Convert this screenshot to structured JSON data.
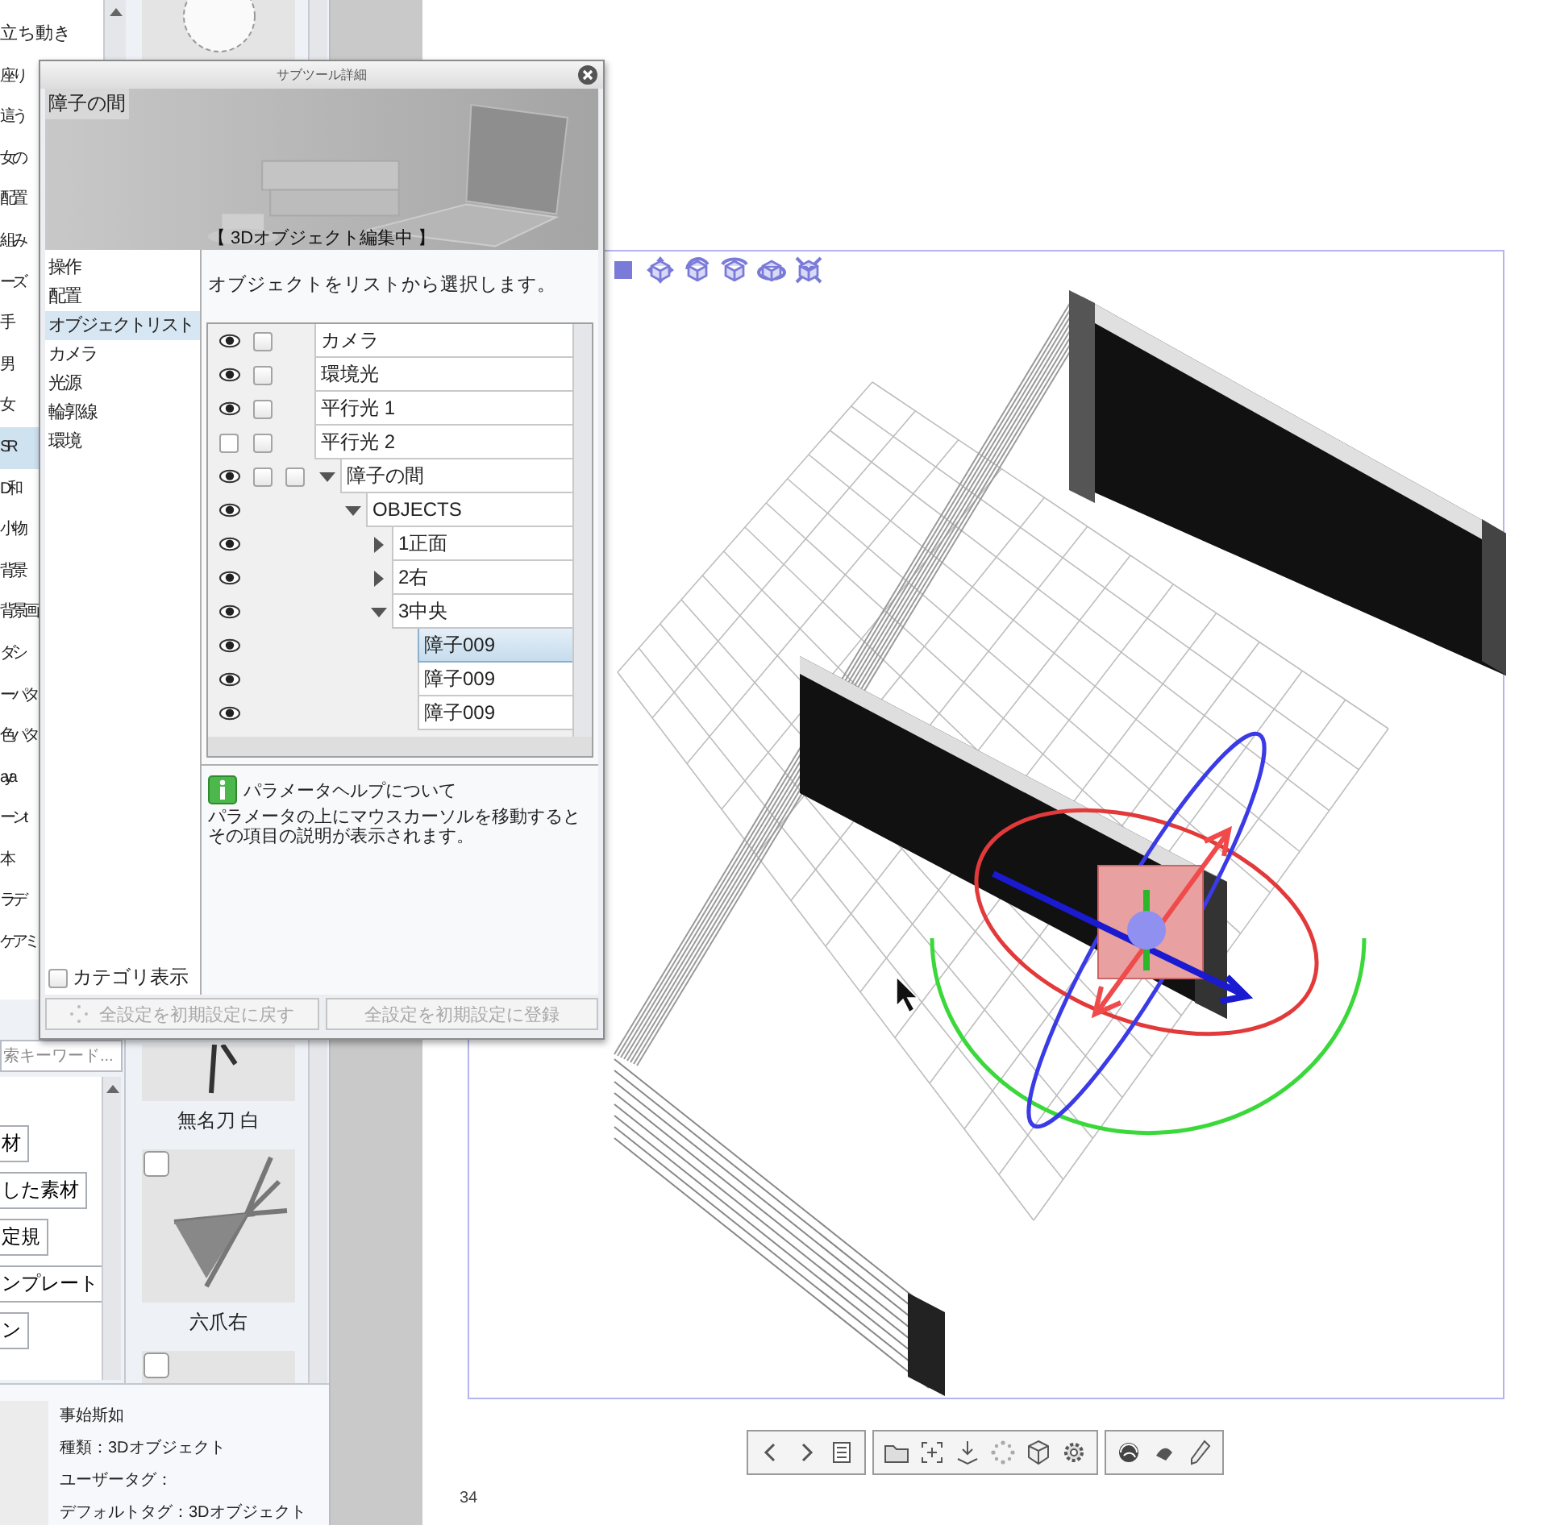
{
  "category_list": {
    "items": [
      {
        "label": "立ち動き",
        "selected": false
      },
      {
        "label": "座り",
        "selected": false
      },
      {
        "label": "這う",
        "selected": false
      },
      {
        "label": "女の",
        "selected": false
      },
      {
        "label": "配置",
        "selected": false
      },
      {
        "label": "組み",
        "selected": false
      },
      {
        "label": "ーズ",
        "selected": false
      },
      {
        "label": "手",
        "selected": false
      },
      {
        "label": "男",
        "selected": false
      },
      {
        "label": "女",
        "selected": false
      },
      {
        "label": "SR",
        "selected": true
      },
      {
        "label": "D和",
        "selected": false
      },
      {
        "label": "小物",
        "selected": false
      },
      {
        "label": "背景",
        "selected": false
      },
      {
        "label": "背景画",
        "selected": false
      },
      {
        "label": "ダシ",
        "selected": false
      },
      {
        "label": "ーパタ",
        "selected": false
      },
      {
        "label": "色パタ",
        "selected": false
      },
      {
        "label": "aya",
        "selected": false
      },
      {
        "label": "ーンt",
        "selected": false
      },
      {
        "label": "本",
        "selected": false
      },
      {
        "label": "ラデ",
        "selected": false
      },
      {
        "label": "ケアミ",
        "selected": false
      }
    ]
  },
  "material_search": {
    "placeholder": "索キーワード..."
  },
  "material_tree": {
    "items": [
      {
        "label": "材"
      },
      {
        "label": "した素材"
      },
      {
        "label": "定規"
      },
      {
        "label": "ンプレート"
      },
      {
        "label": "ン"
      }
    ]
  },
  "materials": [
    {
      "label": "無名刀 白"
    },
    {
      "label": "六爪右",
      "checked": false
    },
    {
      "checked": false
    }
  ],
  "material_info": {
    "name": "事始斯如",
    "lines": [
      "種類：3Dオブジェクト",
      "ユーザータグ：",
      "デフォルトタグ：3Dオブジェクト"
    ]
  },
  "dialog": {
    "title": "サブツール詳細",
    "preview": {
      "name": "障子の間",
      "status": "【 3Dオブジェクト編集中 】"
    },
    "categories": [
      {
        "label": "操作",
        "selected": false
      },
      {
        "label": "配置",
        "selected": false
      },
      {
        "label": "オブジェクトリスト",
        "selected": true
      },
      {
        "label": "カメラ",
        "selected": false
      },
      {
        "label": "光源",
        "selected": false
      },
      {
        "label": "輪郭線",
        "selected": false
      },
      {
        "label": "環境",
        "selected": false
      }
    ],
    "category_display": {
      "label": "カテゴリ表示",
      "checked": false
    },
    "description": "オブジェクトをリストから選択します。",
    "object_tree": [
      {
        "label": "カメラ",
        "visible": true,
        "checks": [
          false
        ],
        "selected": false
      },
      {
        "label": "環境光",
        "visible": true,
        "checks": [
          false
        ],
        "selected": false
      },
      {
        "label": "平行光 1",
        "visible": true,
        "checks": [
          false
        ],
        "selected": false
      },
      {
        "label": "平行光 2",
        "visible": false,
        "checks": [
          false
        ],
        "selected": false
      },
      {
        "label": "障子の間",
        "visible": true,
        "checks": [
          false,
          false
        ],
        "expanded": true,
        "selected": false,
        "children": [
          {
            "label": "OBJECTS",
            "visible": true,
            "expanded": true,
            "selected": false,
            "children": [
              {
                "label": "1正面",
                "visible": true,
                "expanded": false,
                "selected": false
              },
              {
                "label": "2右",
                "visible": true,
                "expanded": false,
                "selected": false
              },
              {
                "label": "3中央",
                "visible": true,
                "expanded": true,
                "selected": false,
                "children": [
                  {
                    "label": "障子009",
                    "visible": true,
                    "selected": true
                  },
                  {
                    "label": "障子009",
                    "visible": true,
                    "selected": false
                  },
                  {
                    "label": "障子009",
                    "visible": true,
                    "selected": false
                  }
                ]
              }
            ]
          }
        ]
      }
    ],
    "help": {
      "title": "パラメータヘルプについて",
      "text": "パラメータの上にマウスカーソルを移動するとその項目の説明が表示されます。"
    },
    "buttons": [
      {
        "label": "全設定を初期設定に戻す",
        "disabled": true
      },
      {
        "label": "全設定を初期設定に登録",
        "disabled": true
      }
    ]
  },
  "canvas": {
    "page_number": "34"
  }
}
